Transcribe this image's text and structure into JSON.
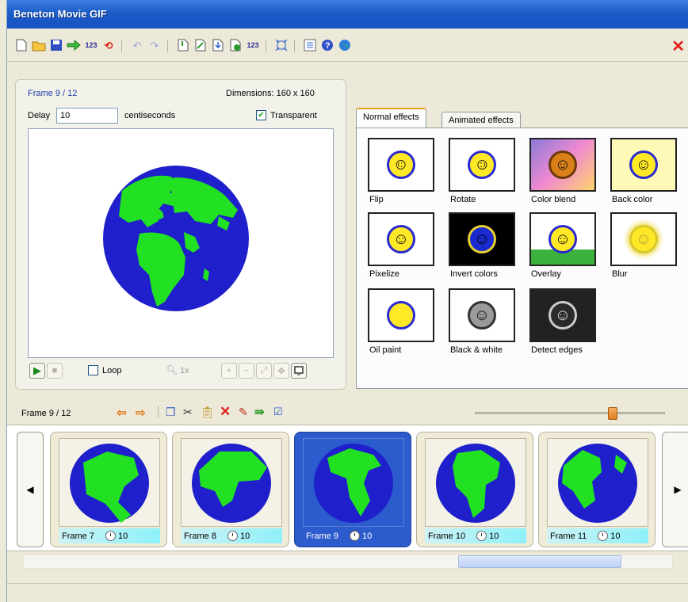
{
  "window": {
    "title": "Beneton Movie GIF",
    "close_glyph": "✕"
  },
  "toolbar": {
    "icons": [
      "new-icon",
      "open-icon",
      "save-icon",
      "export-icon",
      "numbering-icon",
      "reverse-icon",
      "undo-icon",
      "redo-icon",
      "insert-frame-icon",
      "edit-frame-icon",
      "import-icon",
      "add-icon",
      "renumber-icon",
      "resize-icon",
      "properties-icon",
      "help-icon",
      "web-icon"
    ]
  },
  "frame_panel": {
    "frame_label": "Frame 9 / 12",
    "dimensions": "Dimensions: 160 x 160",
    "delay_label": "Delay",
    "delay_value": "10",
    "delay_unit": "centiseconds",
    "transparent_label": "Transparent",
    "transparent_checked": true,
    "loop_label": "Loop",
    "zoom_label": "1x"
  },
  "effects": {
    "tabs": [
      "Normal effects",
      "Animated effects"
    ],
    "active_tab": 0,
    "items": [
      "Flip",
      "Rotate",
      "Color blend",
      "Back color",
      "Pixelize",
      "Invert colors",
      "Overlay",
      "Blur",
      "Oil paint",
      "Black & white",
      "Detect edges"
    ]
  },
  "strip": {
    "frame_label": "Frame 9 / 12",
    "slider_fraction": 0.74,
    "frames": [
      {
        "label": "Frame 7",
        "delay": "10"
      },
      {
        "label": "Frame 8",
        "delay": "10"
      },
      {
        "label": "Frame 9",
        "delay": "10",
        "selected": true
      },
      {
        "label": "Frame 10",
        "delay": "10"
      },
      {
        "label": "Frame 11",
        "delay": "10"
      }
    ],
    "nav_prev_glyph": "◀",
    "nav_next_glyph": "▶"
  },
  "colors": {
    "ocean": "#1f1fcc",
    "land": "#22e022",
    "titlebar": "#1b5cc8",
    "accent": "#e07d1c"
  }
}
